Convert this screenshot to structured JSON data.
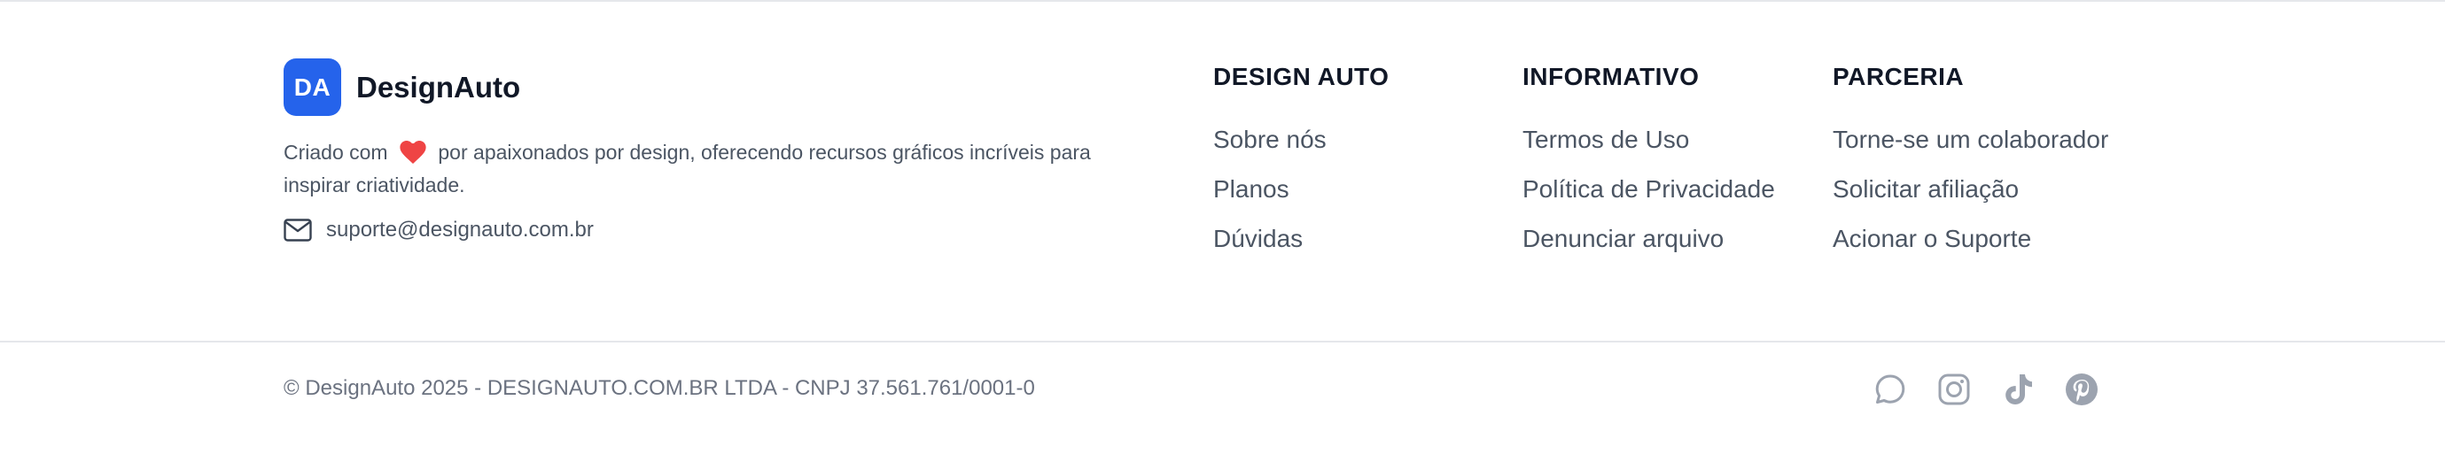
{
  "brand": {
    "logo_text": "DA",
    "name": "DesignAuto",
    "desc_before": "Criado com",
    "desc_after": "por apaixonados por design, oferecendo recursos gráficos incríveis para inspirar criatividade.",
    "email": "suporte@designauto.com.br",
    "accent_color": "#2563eb",
    "heart_color": "#ef4444"
  },
  "columns": [
    {
      "title": "DESIGN AUTO",
      "links": [
        "Sobre nós",
        "Planos",
        "Dúvidas"
      ]
    },
    {
      "title": "INFORMATIVO",
      "links": [
        "Termos de Uso",
        "Política de Privacidade",
        "Denunciar arquivo"
      ]
    },
    {
      "title": "PARCERIA",
      "links": [
        "Torne-se um colaborador",
        "Solicitar afiliação",
        "Acionar o Suporte"
      ]
    }
  ],
  "bottom": {
    "copyright": "© DesignAuto 2025 - DESIGNAUTO.COM.BR LTDA - CNPJ 37.561.761/0001-0",
    "socials": [
      "whatsapp-icon",
      "instagram-icon",
      "tiktok-icon",
      "pinterest-icon"
    ],
    "icon_color": "#9ca3af"
  }
}
